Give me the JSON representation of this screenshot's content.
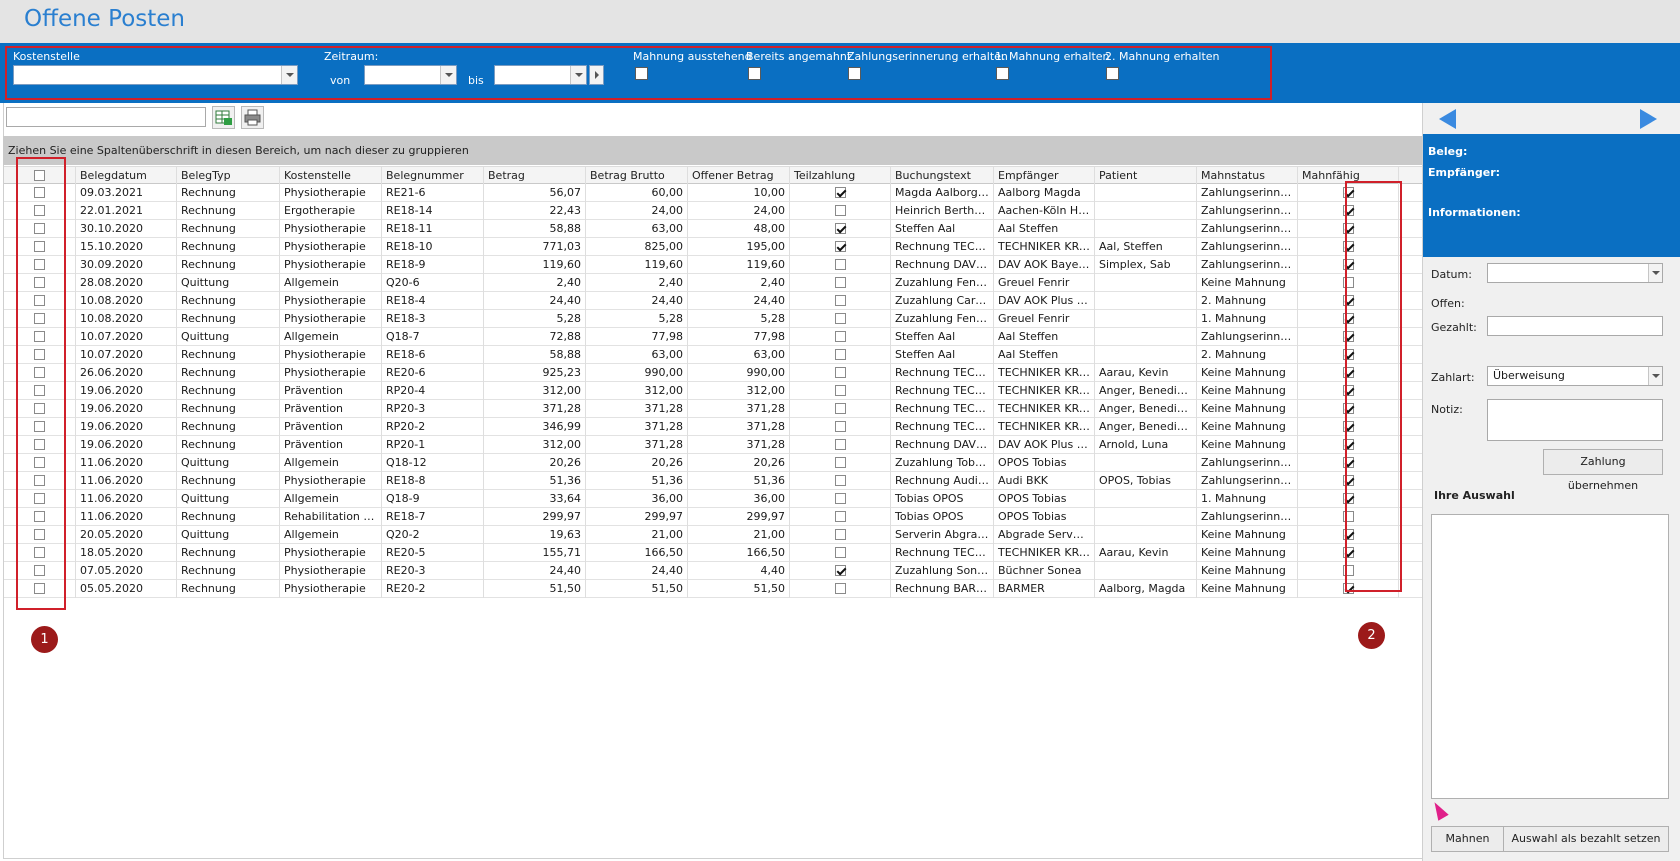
{
  "window": {
    "title": "Offene Posten"
  },
  "filters": {
    "kostenstelle_label": "Kostenstelle",
    "zeitraum_label": "Zeitraum:",
    "von_label": "von",
    "bis_label": "bis",
    "checks": [
      {
        "label": "Mahnung ausstehend",
        "checked": false
      },
      {
        "label": "Bereits angemahnt",
        "checked": false
      },
      {
        "label": "Zahlungserinnerung erhalten",
        "checked": false
      },
      {
        "label": "1. Mahnung erhalten",
        "checked": false
      },
      {
        "label": "2. Mahnung erhalten",
        "checked": false
      }
    ]
  },
  "group_hint": "Ziehen Sie eine Spaltenüberschrift in diesen Bereich, um nach dieser zu gruppieren",
  "table": {
    "columns": [
      "",
      "Belegdatum",
      "BelegTyp",
      "Kostenstelle",
      "Belegnummer",
      "Betrag",
      "Betrag Brutto",
      "Offener Betrag",
      "Teilzahlung",
      "Buchungstext",
      "Empfänger",
      "Patient",
      "Mahnstatus",
      "Mahnfähig"
    ],
    "rows": [
      [
        "09.03.2021",
        "Rechnung",
        "Physiotherapie",
        "RE21-6",
        "56,07",
        "60,00",
        "10,00",
        true,
        "Magda Aalborg K...",
        "Aalborg Magda",
        "",
        "Zahlungserinnerung",
        true
      ],
      [
        "22.01.2021",
        "Rechnung",
        "Ergotherapie",
        "RE18-14",
        "22,43",
        "24,00",
        "24,00",
        false,
        "Heinrich Bertholt ...",
        "Aachen-Köln Hein...",
        "",
        "Zahlungserinnerung",
        true
      ],
      [
        "30.10.2020",
        "Rechnung",
        "Physiotherapie",
        "RE18-11",
        "58,88",
        "63,00",
        "48,00",
        true,
        "Steffen Aal",
        "Aal Steffen",
        "",
        "Zahlungserinnerung",
        true
      ],
      [
        "15.10.2020",
        "Rechnung",
        "Physiotherapie",
        "RE18-10",
        "771,03",
        "825,00",
        "195,00",
        true,
        "Rechnung TECHN...",
        "TECHNIKER KRA...",
        "Aal, Steffen",
        "Zahlungserinnerung",
        true
      ],
      [
        "30.09.2020",
        "Rechnung",
        "Physiotherapie",
        "RE18-9",
        "119,60",
        "119,60",
        "119,60",
        false,
        "Rechnung DAV A...",
        "DAV AOK Bayern ...",
        "Simplex, Sab",
        "Zahlungserinnerung",
        true
      ],
      [
        "28.08.2020",
        "Quittung",
        "Allgemein",
        "Q20-6",
        "2,40",
        "2,40",
        "2,40",
        false,
        "Zuzahlung Fenrir ...",
        "Greuel Fenrir",
        "",
        "Keine Mahnung",
        false
      ],
      [
        "10.08.2020",
        "Rechnung",
        "Physiotherapie",
        "RE18-4",
        "24,40",
        "24,40",
        "24,40",
        false,
        "Zuzahlung Caren...",
        "DAV AOK Plus Sa...",
        "",
        "2. Mahnung",
        true
      ],
      [
        "10.08.2020",
        "Rechnung",
        "Physiotherapie",
        "RE18-3",
        "5,28",
        "5,28",
        "5,28",
        false,
        "Zuzahlung Fenrir ...",
        "Greuel Fenrir",
        "",
        "1. Mahnung",
        true
      ],
      [
        "10.07.2020",
        "Quittung",
        "Allgemein",
        "Q18-7",
        "72,88",
        "77,98",
        "77,98",
        false,
        "Steffen Aal",
        "Aal Steffen",
        "",
        "Zahlungserinnerung",
        true
      ],
      [
        "10.07.2020",
        "Rechnung",
        "Physiotherapie",
        "RE18-6",
        "58,88",
        "63,00",
        "63,00",
        false,
        "Steffen Aal",
        "Aal Steffen",
        "",
        "2. Mahnung",
        true
      ],
      [
        "26.06.2020",
        "Rechnung",
        "Physiotherapie",
        "RE20-6",
        "925,23",
        "990,00",
        "990,00",
        false,
        "Rechnung TECHN...",
        "TECHNIKER KRA...",
        "Aarau, Kevin",
        "Keine Mahnung",
        true
      ],
      [
        "19.06.2020",
        "Rechnung",
        "Prävention",
        "RP20-4",
        "312,00",
        "312,00",
        "312,00",
        false,
        "Rechnung TECHN...",
        "TECHNIKER KRA...",
        "Anger, Benedikta",
        "Keine Mahnung",
        true
      ],
      [
        "19.06.2020",
        "Rechnung",
        "Prävention",
        "RP20-3",
        "371,28",
        "371,28",
        "371,28",
        false,
        "Rechnung TECHN...",
        "TECHNIKER KRA...",
        "Anger, Benedikta",
        "Keine Mahnung",
        true
      ],
      [
        "19.06.2020",
        "Rechnung",
        "Prävention",
        "RP20-2",
        "346,99",
        "371,28",
        "371,28",
        false,
        "Rechnung TECHN...",
        "TECHNIKER KRA...",
        "Anger, Benedikta",
        "Keine Mahnung",
        true
      ],
      [
        "19.06.2020",
        "Rechnung",
        "Prävention",
        "RP20-1",
        "312,00",
        "371,28",
        "371,28",
        false,
        "Rechnung DAV A...",
        "DAV AOK Plus Sa...",
        "Arnold, Luna",
        "Keine Mahnung",
        true
      ],
      [
        "11.06.2020",
        "Quittung",
        "Allgemein",
        "Q18-12",
        "20,26",
        "20,26",
        "20,26",
        false,
        "Zuzahlung Tobias...",
        "OPOS Tobias",
        "",
        "Zahlungserinnerung",
        true
      ],
      [
        "11.06.2020",
        "Rechnung",
        "Physiotherapie",
        "RE18-8",
        "51,36",
        "51,36",
        "51,36",
        false,
        "Rechnung Audi BKK",
        "Audi BKK",
        "OPOS, Tobias",
        "Zahlungserinnerung",
        true
      ],
      [
        "11.06.2020",
        "Quittung",
        "Allgemein",
        "Q18-9",
        "33,64",
        "36,00",
        "36,00",
        false,
        "Tobias OPOS",
        "OPOS Tobias",
        "",
        "1. Mahnung",
        true
      ],
      [
        "11.06.2020",
        "Rechnung",
        "Rehabilitation üb...",
        "RE18-7",
        "299,97",
        "299,97",
        "299,97",
        false,
        "Tobias OPOS",
        "OPOS Tobias",
        "",
        "Zahlungserinnerung",
        false
      ],
      [
        "20.05.2020",
        "Quittung",
        "Allgemein",
        "Q20-2",
        "19,63",
        "21,00",
        "21,00",
        false,
        "Serverin Abgrade",
        "Abgrade Serverin",
        "",
        "Keine Mahnung",
        true
      ],
      [
        "18.05.2020",
        "Rechnung",
        "Physiotherapie",
        "RE20-5",
        "155,71",
        "166,50",
        "166,50",
        false,
        "Rechnung TECHN...",
        "TECHNIKER KRA...",
        "Aarau, Kevin",
        "Keine Mahnung",
        true
      ],
      [
        "07.05.2020",
        "Rechnung",
        "Physiotherapie",
        "RE20-3",
        "24,40",
        "24,40",
        "4,40",
        true,
        "Zuzahlung Sonea ...",
        "Büchner Sonea",
        "",
        "Keine Mahnung",
        false
      ],
      [
        "05.05.2020",
        "Rechnung",
        "Physiotherapie",
        "RE20-2",
        "51,50",
        "51,50",
        "51,50",
        false,
        "Rechnung BARMER",
        "BARMER",
        "Aalborg, Magda",
        "Keine Mahnung",
        true
      ]
    ]
  },
  "markers": [
    "1",
    "2"
  ],
  "side_panel": {
    "beleg_label": "Beleg:",
    "empfaenger_label": "Empfänger:",
    "informationen_label": "Informationen:",
    "datum_label": "Datum:",
    "offen_label": "Offen:",
    "gezahlt_label": "Gezahlt:",
    "zahlart_label": "Zahlart:",
    "zahlart_value": "Überweisung",
    "notiz_label": "Notiz:",
    "zahlung_button": "Zahlung übernehmen",
    "auswahl_title": "Ihre Auswahl",
    "mahnen_button": "Mahnen",
    "bezahlt_button": "Auswahl als bezahlt setzen"
  },
  "colors": {
    "accent_blue": "#0a6fc2",
    "title_blue": "#2a7fd0",
    "highlight_red": "#d0202a",
    "marker_red": "#9c1a1a"
  }
}
